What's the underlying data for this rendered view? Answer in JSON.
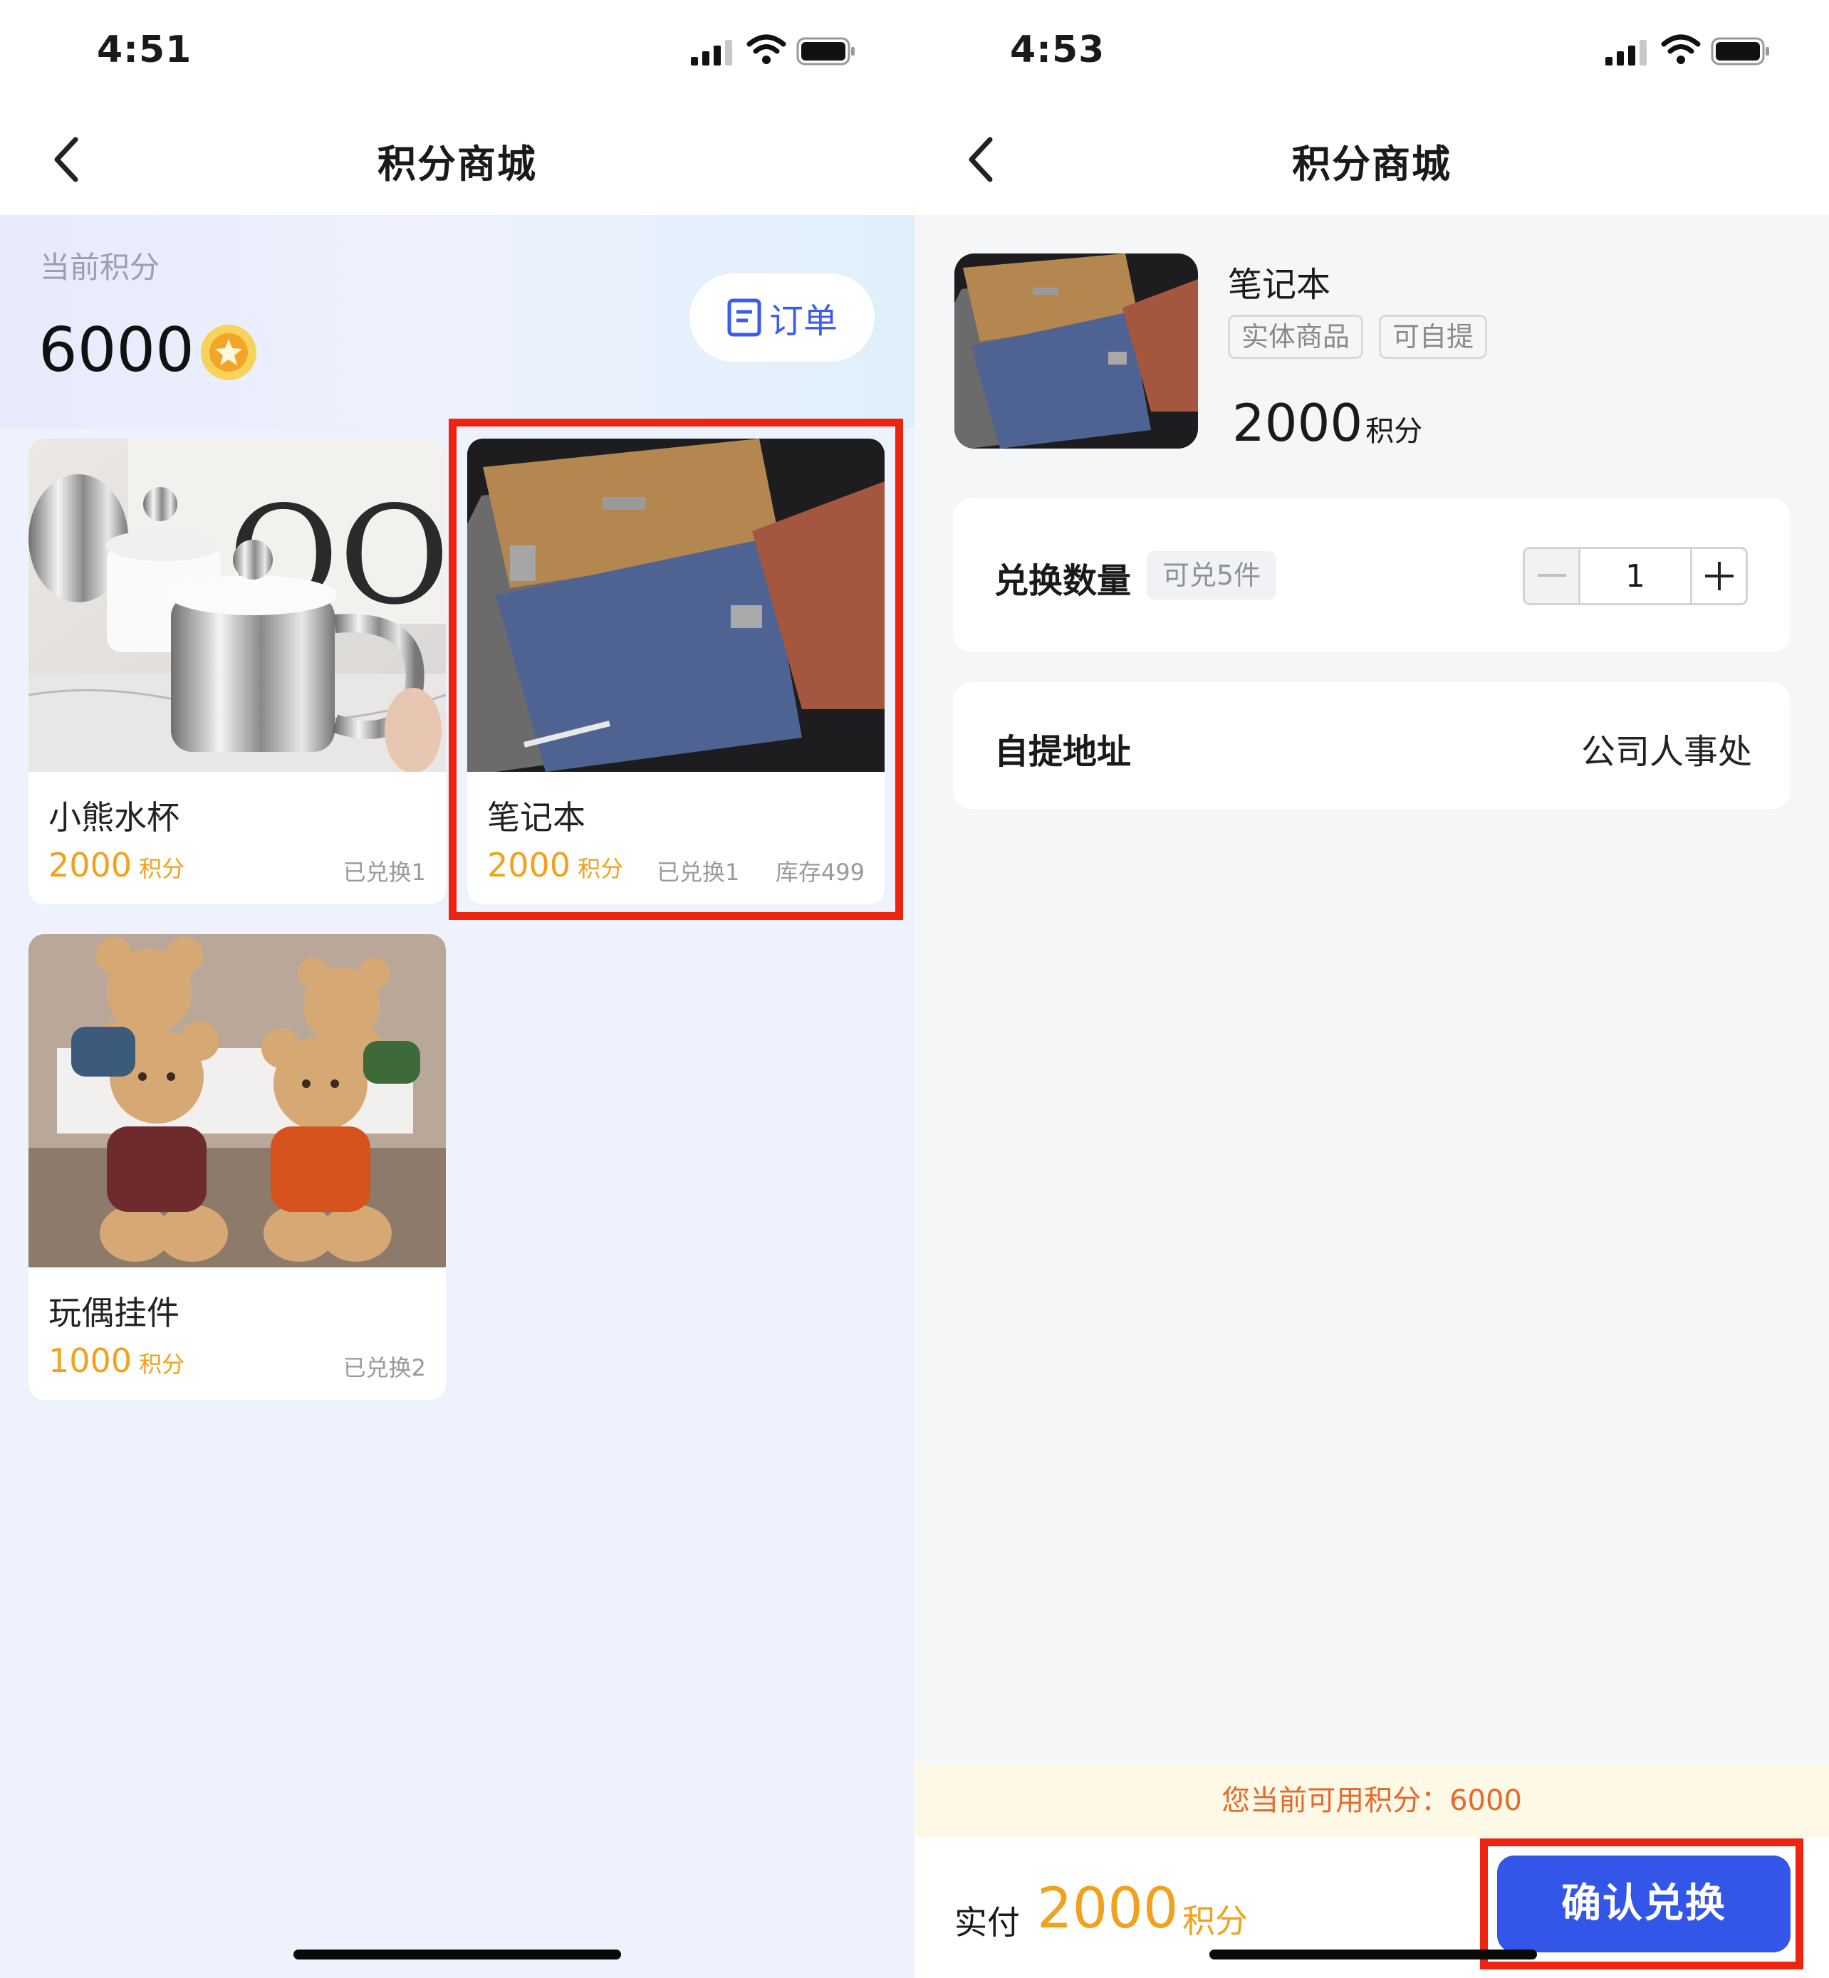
{
  "left": {
    "status": {
      "time": "4:51"
    },
    "nav": {
      "title": "积分商城"
    },
    "points": {
      "label": "当前积分",
      "value": "6000"
    },
    "order_button": {
      "label": "订单"
    },
    "products": [
      {
        "name": "小熊水杯",
        "price": "2000",
        "unit": "积分",
        "redeemed": "已兑换1",
        "stock": ""
      },
      {
        "name": "笔记本",
        "price": "2000",
        "unit": "积分",
        "redeemed": "已兑换1",
        "stock": "库存499"
      },
      {
        "name": "玩偶挂件",
        "price": "1000",
        "unit": "积分",
        "redeemed": "已兑换2",
        "stock": ""
      }
    ]
  },
  "right": {
    "status": {
      "time": "4:53"
    },
    "nav": {
      "title": "积分商城"
    },
    "product": {
      "name": "笔记本",
      "tags": [
        "实体商品",
        "可自提"
      ],
      "price": "2000",
      "unit": "积分"
    },
    "quantity": {
      "label": "兑换数量",
      "limit": "可兑5件",
      "value": "1"
    },
    "address": {
      "label": "自提地址",
      "value": "公司人事处"
    },
    "notice": "您当前可用积分：6000",
    "footer": {
      "pay_label": "实付",
      "amount": "2000",
      "unit": "积分",
      "confirm_label": "确认兑换"
    }
  },
  "colors": {
    "accent": "#3356e8",
    "price": "#f0a21e",
    "highlight": "#ee2410",
    "notice": "#e6692c"
  },
  "icons": [
    "back-chevron-icon",
    "signal-icon",
    "wifi-icon",
    "battery-icon",
    "coin-icon",
    "order-list-icon",
    "minus-icon",
    "plus-icon"
  ]
}
